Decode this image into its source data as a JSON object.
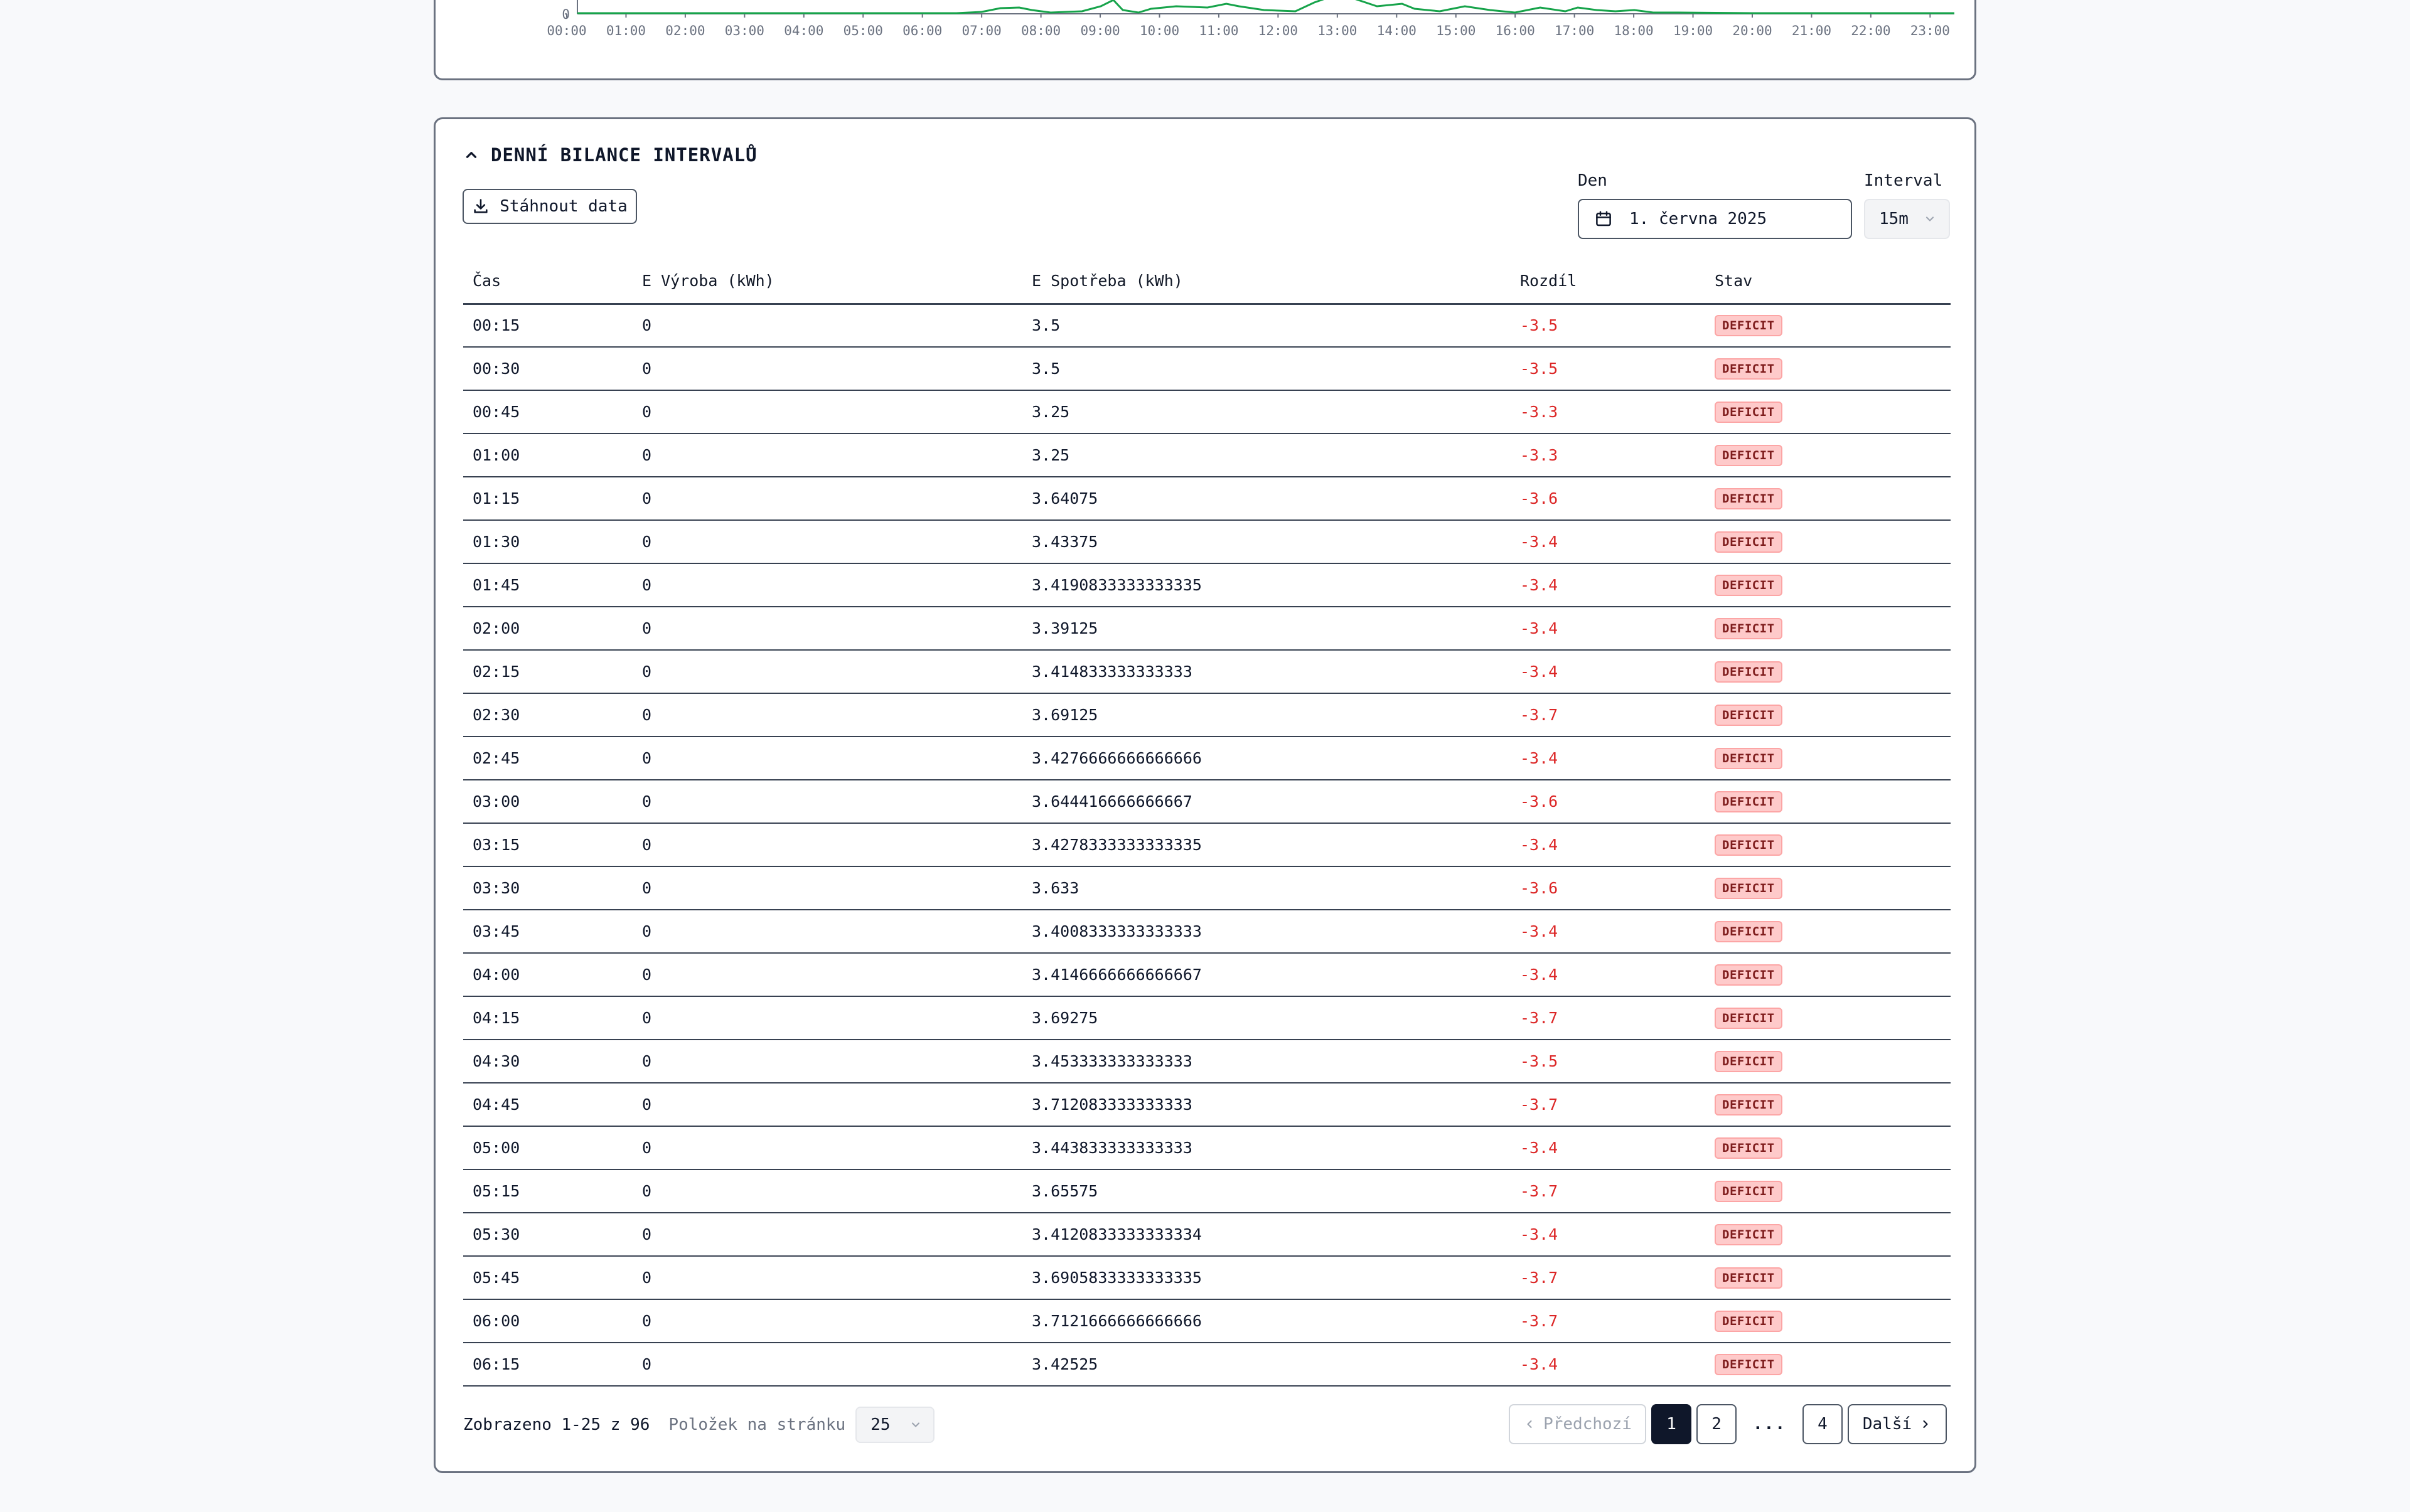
{
  "chart": {
    "y_tick": "0",
    "x_ticks": [
      "00:00",
      "01:00",
      "02:00",
      "03:00",
      "04:00",
      "05:00",
      "06:00",
      "07:00",
      "08:00",
      "09:00",
      "10:00",
      "11:00",
      "12:00",
      "13:00",
      "14:00",
      "15:00",
      "16:00",
      "17:00",
      "18:00",
      "19:00",
      "20:00",
      "21:00",
      "22:00",
      "23:00"
    ],
    "line_color": "#16a34a"
  },
  "section": {
    "title": "DENNÍ BILANCE INTERVALŮ"
  },
  "toolbar": {
    "download_label": "Stáhnout data",
    "day_label": "Den",
    "day_value": "1. června 2025",
    "interval_label": "Interval",
    "interval_value": "15m"
  },
  "table": {
    "headers": [
      "Čas",
      "E Výroba (kWh)",
      "E Spotřeba (kWh)",
      "Rozdíl",
      "Stav"
    ],
    "rows": [
      {
        "time": "00:15",
        "prod": "0",
        "cons": "3.5",
        "diff": "-3.5",
        "status": "DEFICIT"
      },
      {
        "time": "00:30",
        "prod": "0",
        "cons": "3.5",
        "diff": "-3.5",
        "status": "DEFICIT"
      },
      {
        "time": "00:45",
        "prod": "0",
        "cons": "3.25",
        "diff": "-3.3",
        "status": "DEFICIT"
      },
      {
        "time": "01:00",
        "prod": "0",
        "cons": "3.25",
        "diff": "-3.3",
        "status": "DEFICIT"
      },
      {
        "time": "01:15",
        "prod": "0",
        "cons": "3.64075",
        "diff": "-3.6",
        "status": "DEFICIT"
      },
      {
        "time": "01:30",
        "prod": "0",
        "cons": "3.43375",
        "diff": "-3.4",
        "status": "DEFICIT"
      },
      {
        "time": "01:45",
        "prod": "0",
        "cons": "3.4190833333333335",
        "diff": "-3.4",
        "status": "DEFICIT"
      },
      {
        "time": "02:00",
        "prod": "0",
        "cons": "3.39125",
        "diff": "-3.4",
        "status": "DEFICIT"
      },
      {
        "time": "02:15",
        "prod": "0",
        "cons": "3.414833333333333",
        "diff": "-3.4",
        "status": "DEFICIT"
      },
      {
        "time": "02:30",
        "prod": "0",
        "cons": "3.69125",
        "diff": "-3.7",
        "status": "DEFICIT"
      },
      {
        "time": "02:45",
        "prod": "0",
        "cons": "3.4276666666666666",
        "diff": "-3.4",
        "status": "DEFICIT"
      },
      {
        "time": "03:00",
        "prod": "0",
        "cons": "3.644416666666667",
        "diff": "-3.6",
        "status": "DEFICIT"
      },
      {
        "time": "03:15",
        "prod": "0",
        "cons": "3.4278333333333335",
        "diff": "-3.4",
        "status": "DEFICIT"
      },
      {
        "time": "03:30",
        "prod": "0",
        "cons": "3.633",
        "diff": "-3.6",
        "status": "DEFICIT"
      },
      {
        "time": "03:45",
        "prod": "0",
        "cons": "3.4008333333333333",
        "diff": "-3.4",
        "status": "DEFICIT"
      },
      {
        "time": "04:00",
        "prod": "0",
        "cons": "3.4146666666666667",
        "diff": "-3.4",
        "status": "DEFICIT"
      },
      {
        "time": "04:15",
        "prod": "0",
        "cons": "3.69275",
        "diff": "-3.7",
        "status": "DEFICIT"
      },
      {
        "time": "04:30",
        "prod": "0",
        "cons": "3.453333333333333",
        "diff": "-3.5",
        "status": "DEFICIT"
      },
      {
        "time": "04:45",
        "prod": "0",
        "cons": "3.712083333333333",
        "diff": "-3.7",
        "status": "DEFICIT"
      },
      {
        "time": "05:00",
        "prod": "0",
        "cons": "3.443833333333333",
        "diff": "-3.4",
        "status": "DEFICIT"
      },
      {
        "time": "05:15",
        "prod": "0",
        "cons": "3.65575",
        "diff": "-3.7",
        "status": "DEFICIT"
      },
      {
        "time": "05:30",
        "prod": "0",
        "cons": "3.4120833333333334",
        "diff": "-3.4",
        "status": "DEFICIT"
      },
      {
        "time": "05:45",
        "prod": "0",
        "cons": "3.6905833333333335",
        "diff": "-3.7",
        "status": "DEFICIT"
      },
      {
        "time": "06:00",
        "prod": "0",
        "cons": "3.7121666666666666",
        "diff": "-3.7",
        "status": "DEFICIT"
      },
      {
        "time": "06:15",
        "prod": "0",
        "cons": "3.42525",
        "diff": "-3.4",
        "status": "DEFICIT"
      }
    ]
  },
  "footer": {
    "shown_text": "Zobrazeno 1-25 z 96",
    "per_page_label": "Položek na stránku",
    "per_page_value": "25"
  },
  "pagination": {
    "prev_label": "Předchozí",
    "pages": [
      "1",
      "2"
    ],
    "ellipsis": "...",
    "last_page": "4",
    "next_label": "Další",
    "current": "1"
  },
  "colors": {
    "deficit_text": "#dc2626",
    "deficit_badge_bg": "#fecaca",
    "active_page_bg": "#0f172a"
  }
}
